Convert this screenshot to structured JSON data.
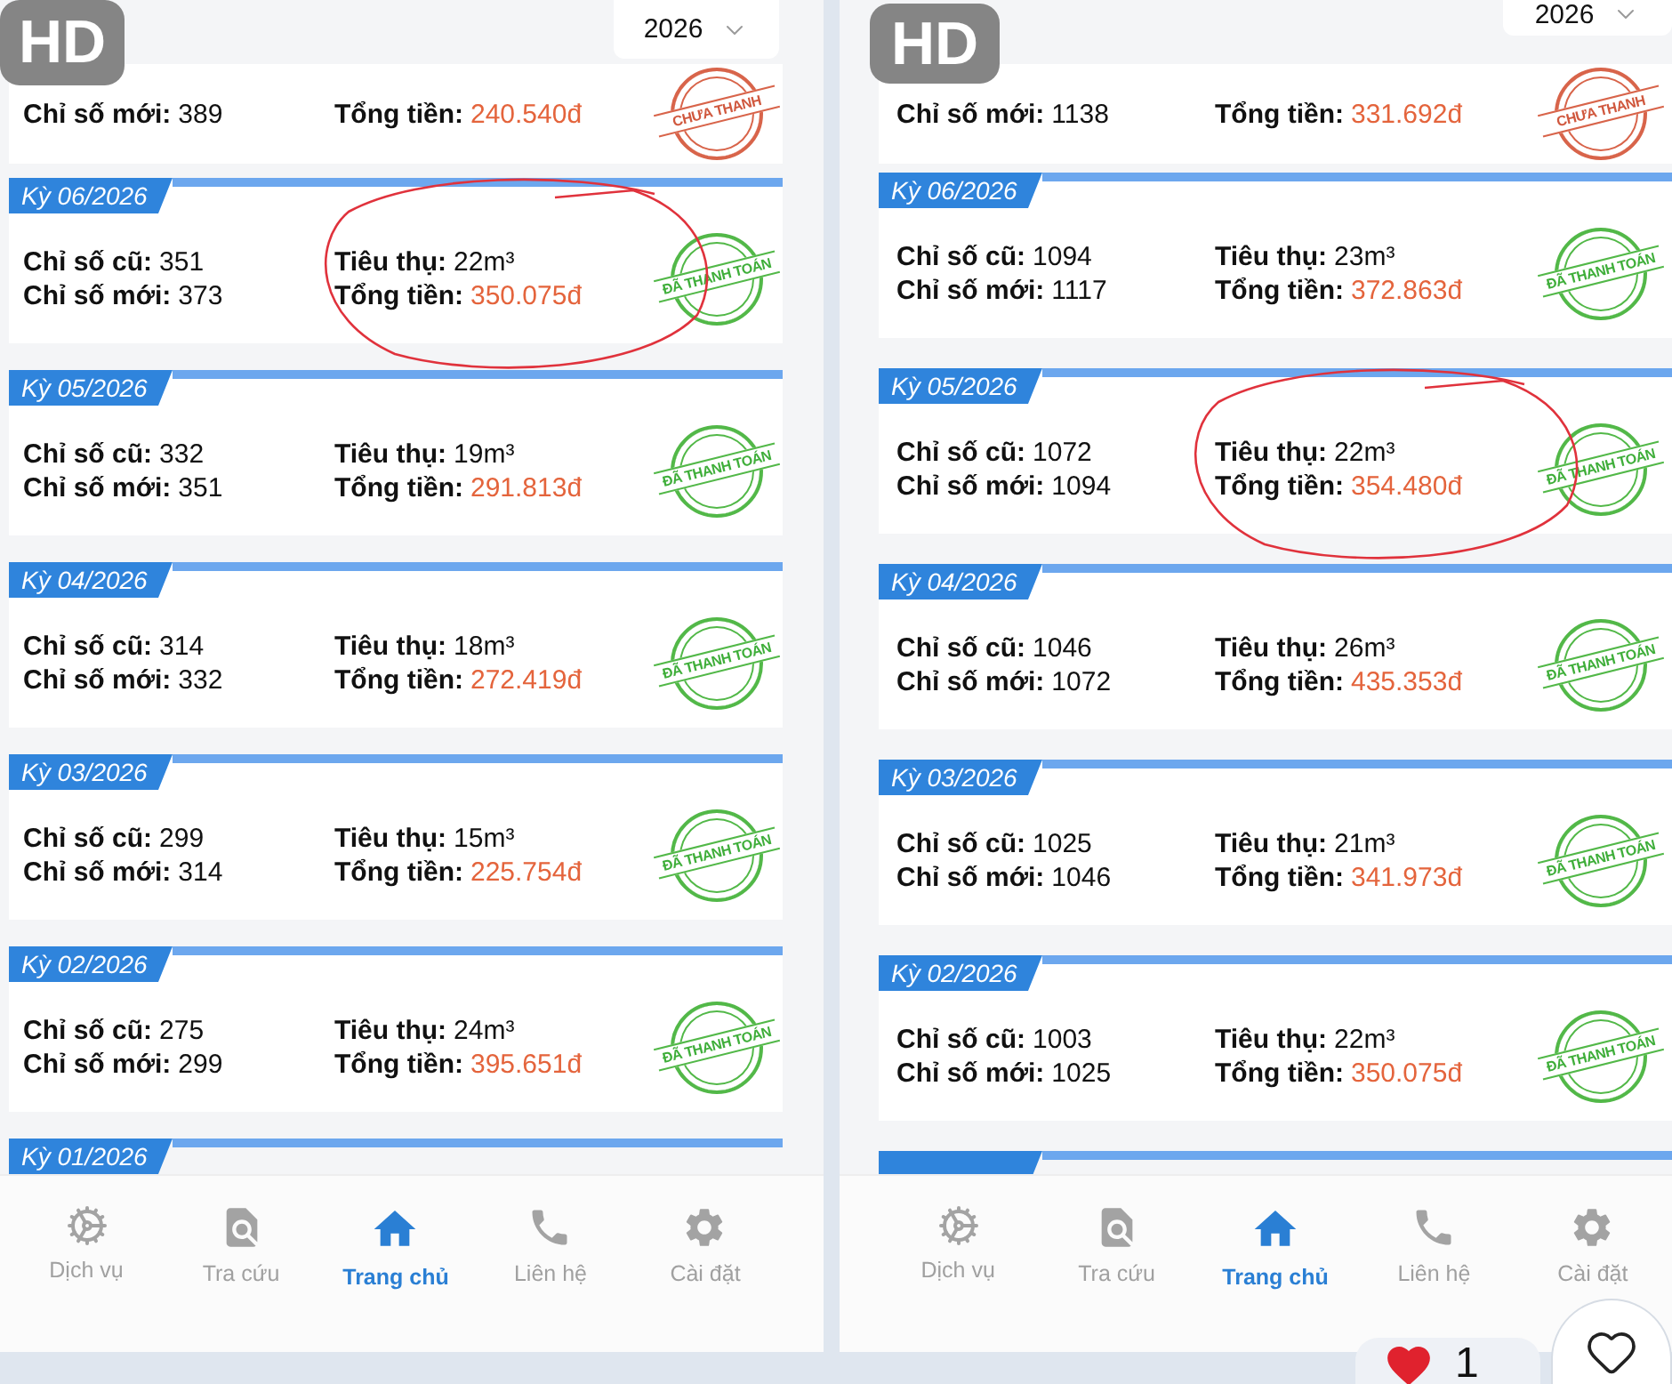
{
  "panels": [
    {
      "hd_badge": "HD",
      "year_select": {
        "value": "2026"
      },
      "cards": [
        {
          "kind": "partial",
          "new_label": "Chỉ số mới:",
          "new_value": "389",
          "total_label": "Tổng tiền:",
          "total_value": "240.540đ",
          "paid": false,
          "stamp": "CHƯA THANH",
          "circled": false
        },
        {
          "kind": "full",
          "period": "Kỳ 06/2026",
          "old_label": "Chỉ số cũ:",
          "old_value": "351",
          "new_label": "Chỉ số mới:",
          "new_value": "373",
          "usage_label": "Tiêu thụ:",
          "usage_value": "22m³",
          "total_label": "Tổng tiền:",
          "total_value": "350.075đ",
          "paid": true,
          "stamp": "ĐÃ THANH TOÁN",
          "circled": true
        },
        {
          "kind": "full",
          "period": "Kỳ 05/2026",
          "old_label": "Chỉ số cũ:",
          "old_value": "332",
          "new_label": "Chỉ số mới:",
          "new_value": "351",
          "usage_label": "Tiêu thụ:",
          "usage_value": "19m³",
          "total_label": "Tổng tiền:",
          "total_value": "291.813đ",
          "paid": true,
          "stamp": "ĐÃ THANH TOÁN",
          "circled": false
        },
        {
          "kind": "full",
          "period": "Kỳ 04/2026",
          "old_label": "Chỉ số cũ:",
          "old_value": "314",
          "new_label": "Chỉ số mới:",
          "new_value": "332",
          "usage_label": "Tiêu thụ:",
          "usage_value": "18m³",
          "total_label": "Tổng tiền:",
          "total_value": "272.419đ",
          "paid": true,
          "stamp": "ĐÃ THANH TOÁN",
          "circled": false
        },
        {
          "kind": "full",
          "period": "Kỳ 03/2026",
          "old_label": "Chỉ số cũ:",
          "old_value": "299",
          "new_label": "Chỉ số mới:",
          "new_value": "314",
          "usage_label": "Tiêu thụ:",
          "usage_value": "15m³",
          "total_label": "Tổng tiền:",
          "total_value": "225.754đ",
          "paid": true,
          "stamp": "ĐÃ THANH TOÁN",
          "circled": false
        },
        {
          "kind": "full",
          "period": "Kỳ 02/2026",
          "old_label": "Chỉ số cũ:",
          "old_value": "275",
          "new_label": "Chỉ số mới:",
          "new_value": "299",
          "usage_label": "Tiêu thụ:",
          "usage_value": "24m³",
          "total_label": "Tổng tiền:",
          "total_value": "395.651đ",
          "paid": true,
          "stamp": "ĐÃ THANH TOÁN",
          "circled": false
        },
        {
          "kind": "header",
          "period": "Kỳ 01/2026"
        }
      ],
      "nav": [
        {
          "label": "Dịch vụ",
          "selected": false
        },
        {
          "label": "Tra cứu",
          "selected": false
        },
        {
          "label": "Trang chủ",
          "selected": true
        },
        {
          "label": "Liên hệ",
          "selected": false
        },
        {
          "label": "Cài đặt",
          "selected": false
        }
      ]
    },
    {
      "hd_badge": "HD",
      "year_select": {
        "value": "2026"
      },
      "cards": [
        {
          "kind": "partial",
          "new_label": "Chỉ số mới:",
          "new_value": "1138",
          "total_label": "Tổng tiền:",
          "total_value": "331.692đ",
          "paid": false,
          "stamp": "CHƯA THANH",
          "circled": false
        },
        {
          "kind": "full",
          "period": "Kỳ 06/2026",
          "old_label": "Chỉ số cũ:",
          "old_value": "1094",
          "new_label": "Chỉ số mới:",
          "new_value": "1117",
          "usage_label": "Tiêu thụ:",
          "usage_value": "23m³",
          "total_label": "Tổng tiền:",
          "total_value": "372.863đ",
          "paid": true,
          "stamp": "ĐÃ THANH TOÁN",
          "circled": false
        },
        {
          "kind": "full",
          "period": "Kỳ 05/2026",
          "old_label": "Chỉ số cũ:",
          "old_value": "1072",
          "new_label": "Chỉ số mới:",
          "new_value": "1094",
          "usage_label": "Tiêu thụ:",
          "usage_value": "22m³",
          "total_label": "Tổng tiền:",
          "total_value": "354.480đ",
          "paid": true,
          "stamp": "ĐÃ THANH TOÁN",
          "circled": true
        },
        {
          "kind": "full",
          "period": "Kỳ 04/2026",
          "old_label": "Chỉ số cũ:",
          "old_value": "1046",
          "new_label": "Chỉ số mới:",
          "new_value": "1072",
          "usage_label": "Tiêu thụ:",
          "usage_value": "26m³",
          "total_label": "Tổng tiền:",
          "total_value": "435.353đ",
          "paid": true,
          "stamp": "ĐÃ THANH TOÁN",
          "circled": false
        },
        {
          "kind": "full",
          "period": "Kỳ 03/2026",
          "old_label": "Chỉ số cũ:",
          "old_value": "1025",
          "new_label": "Chỉ số mới:",
          "new_value": "1046",
          "usage_label": "Tiêu thụ:",
          "usage_value": "21m³",
          "total_label": "Tổng tiền:",
          "total_value": "341.973đ",
          "paid": true,
          "stamp": "ĐÃ THANH TOÁN",
          "circled": false
        },
        {
          "kind": "full",
          "period": "Kỳ 02/2026",
          "old_label": "Chỉ số cũ:",
          "old_value": "1003",
          "new_label": "Chỉ số mới:",
          "new_value": "1025",
          "usage_label": "Tiêu thụ:",
          "usage_value": "22m³",
          "total_label": "Tổng tiền:",
          "total_value": "350.075đ",
          "paid": true,
          "stamp": "ĐÃ THANH TOÁN",
          "circled": false
        },
        {
          "kind": "header"
        }
      ],
      "nav": [
        {
          "label": "Dịch vụ",
          "selected": false
        },
        {
          "label": "Tra cứu",
          "selected": false
        },
        {
          "label": "Trang chủ",
          "selected": true
        },
        {
          "label": "Liên hệ",
          "selected": false
        },
        {
          "label": "Cài đặt",
          "selected": false
        }
      ]
    }
  ],
  "reactions": {
    "count": "1"
  }
}
